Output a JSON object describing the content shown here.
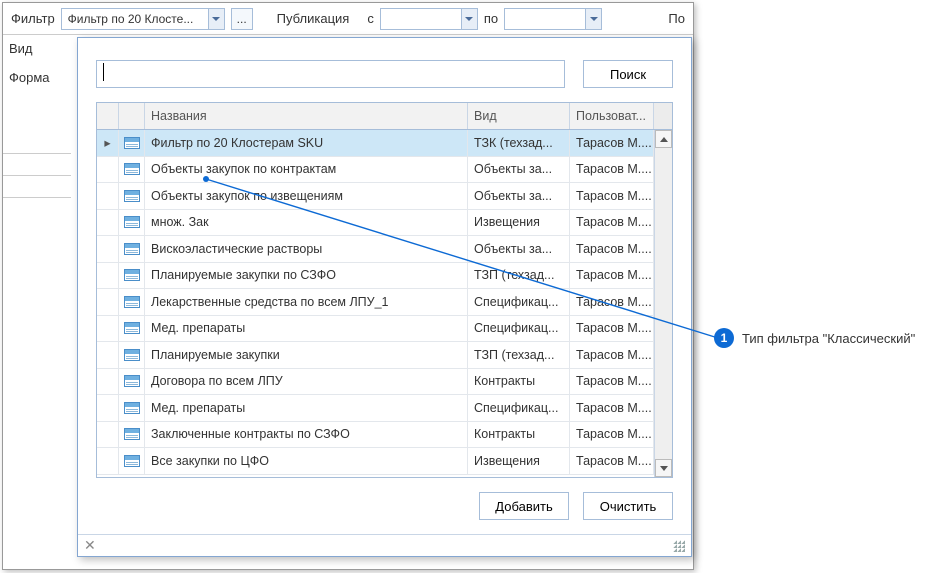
{
  "topbar": {
    "filter_label": "Фильтр",
    "filter_combo_text": "Фильтр по 20 Клосте...",
    "pub_label": "Публикация",
    "from_label": "с",
    "to_label": "по",
    "po_right": "По"
  },
  "side": {
    "vid": "Вид",
    "forma": "Форма"
  },
  "popup": {
    "search_btn": "Поиск",
    "add_btn": "Добавить",
    "clear_btn": "Очистить",
    "columns": {
      "name": "Названия",
      "vid": "Вид",
      "user": "Пользоват..."
    },
    "rows": [
      {
        "name": "Фильтр по 20 Клостерам SKU",
        "vid": "ТЗК (техзад...",
        "user": "Тарасов М....",
        "selected": true
      },
      {
        "name": "Объекты закупок по контрактам",
        "vid": "Объекты за...",
        "user": "Тарасов М...."
      },
      {
        "name": "Объекты закупок по извещениям",
        "vid": "Объекты за...",
        "user": "Тарасов М...."
      },
      {
        "name": "множ. Зак",
        "vid": "Извещения",
        "user": "Тарасов М...."
      },
      {
        "name": "Вискоэластические растворы",
        "vid": "Объекты за...",
        "user": "Тарасов М...."
      },
      {
        "name": "Планируемые закупки по СЗФО",
        "vid": "ТЗП (техзад...",
        "user": "Тарасов М...."
      },
      {
        "name": "Лекарственные средства по всем ЛПУ_1",
        "vid": "Спецификац...",
        "user": "Тарасов М...."
      },
      {
        "name": "Мед. препараты",
        "vid": "Спецификац...",
        "user": "Тарасов М...."
      },
      {
        "name": "Планируемые закупки",
        "vid": "ТЗП (техзад...",
        "user": "Тарасов М...."
      },
      {
        "name": "Договора по всем ЛПУ",
        "vid": "Контракты",
        "user": "Тарасов М...."
      },
      {
        "name": "Мед. препараты",
        "vid": "Спецификац...",
        "user": "Тарасов М...."
      },
      {
        "name": "Заключенные контракты по СЗФО",
        "vid": "Контракты",
        "user": "Тарасов М...."
      },
      {
        "name": "Все закупки по ЦФО",
        "vid": "Извещения",
        "user": "Тарасов М...."
      }
    ]
  },
  "callout": {
    "num": "1",
    "text": "Тип фильтра \"Классический\""
  }
}
